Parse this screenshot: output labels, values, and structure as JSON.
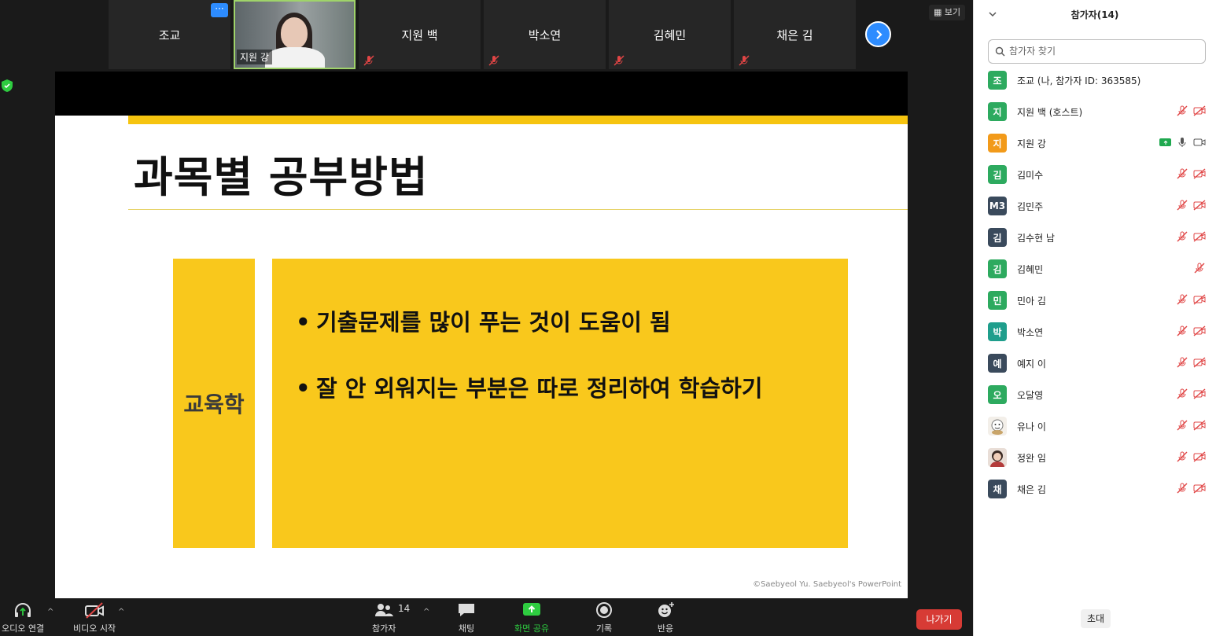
{
  "strip": {
    "tiles": [
      {
        "name": "조교",
        "muted": false
      },
      {
        "name": "지원 강",
        "video": true
      },
      {
        "name": "지원 백",
        "muted": true
      },
      {
        "name": "박소연",
        "muted": true
      },
      {
        "name": "김혜민",
        "muted": true
      },
      {
        "name": "채은 김",
        "muted": true
      }
    ],
    "more_label": "···"
  },
  "view_label": "보기",
  "slide": {
    "title": "과목별 공부방법",
    "subject_label": "교육학",
    "bullets": [
      "기출문제를 많이 푸는 것이 도움이 됨",
      "잘 안 외워지는 부분은 따로 정리하여 학습하기"
    ],
    "credit": "©Saebyeol Yu. Saebyeol's PowerPoint"
  },
  "toolbar": {
    "audio": "오디오 연결",
    "video": "비디오 시작",
    "participants": "참가자",
    "participants_count": "14",
    "chat": "채팅",
    "share": "화면 공유",
    "record": "기록",
    "reactions": "반응",
    "leave": "나가기"
  },
  "panel": {
    "title": "참가자(14)",
    "search_placeholder": "참가자 찾기",
    "invite": "초대",
    "participants": [
      {
        "initial": "조",
        "name": "조교 (나, 참가자 ID: 363585)",
        "color": "#2daa5f",
        "icons": "none"
      },
      {
        "initial": "지",
        "name": "지원 백 (호스트)",
        "color": "#2daa5f",
        "icons": "muted-video"
      },
      {
        "initial": "지",
        "name": "지원 강",
        "color": "#f29a1a",
        "icons": "share-mic-video"
      },
      {
        "initial": "김",
        "name": "김미수",
        "color": "#2daa5f",
        "icons": "muted-video"
      },
      {
        "initial": "M3",
        "name": "김민주",
        "color": "#3a4a5c",
        "icons": "muted-video"
      },
      {
        "initial": "김",
        "name": "김수현 남",
        "color": "#3a4a5c",
        "icons": "muted-video"
      },
      {
        "initial": "김",
        "name": "김혜민",
        "color": "#2daa5f",
        "icons": "muted"
      },
      {
        "initial": "민",
        "name": "민아 김",
        "color": "#2daa5f",
        "icons": "muted-video"
      },
      {
        "initial": "박",
        "name": "박소연",
        "color": "#1f9e8c",
        "icons": "muted-video"
      },
      {
        "initial": "예",
        "name": "예지 이",
        "color": "#3a4a5c",
        "icons": "muted-video"
      },
      {
        "initial": "오",
        "name": "오달영",
        "color": "#2daa5f",
        "icons": "muted-video"
      },
      {
        "initial": "",
        "name": "유나 이",
        "color": "#f3efe9",
        "icons": "muted-video",
        "avatar": "img1"
      },
      {
        "initial": "",
        "name": "정완 임",
        "color": "#e9ded7",
        "icons": "muted-video",
        "avatar": "img2"
      },
      {
        "initial": "채",
        "name": "채은 김",
        "color": "#3a4a5c",
        "icons": "muted-video"
      }
    ]
  },
  "colors": {
    "accent_yellow": "#f9c81c",
    "zoom_blue": "#2d8cff",
    "leave_red": "#d73b35",
    "share_green": "#2ecc40"
  }
}
